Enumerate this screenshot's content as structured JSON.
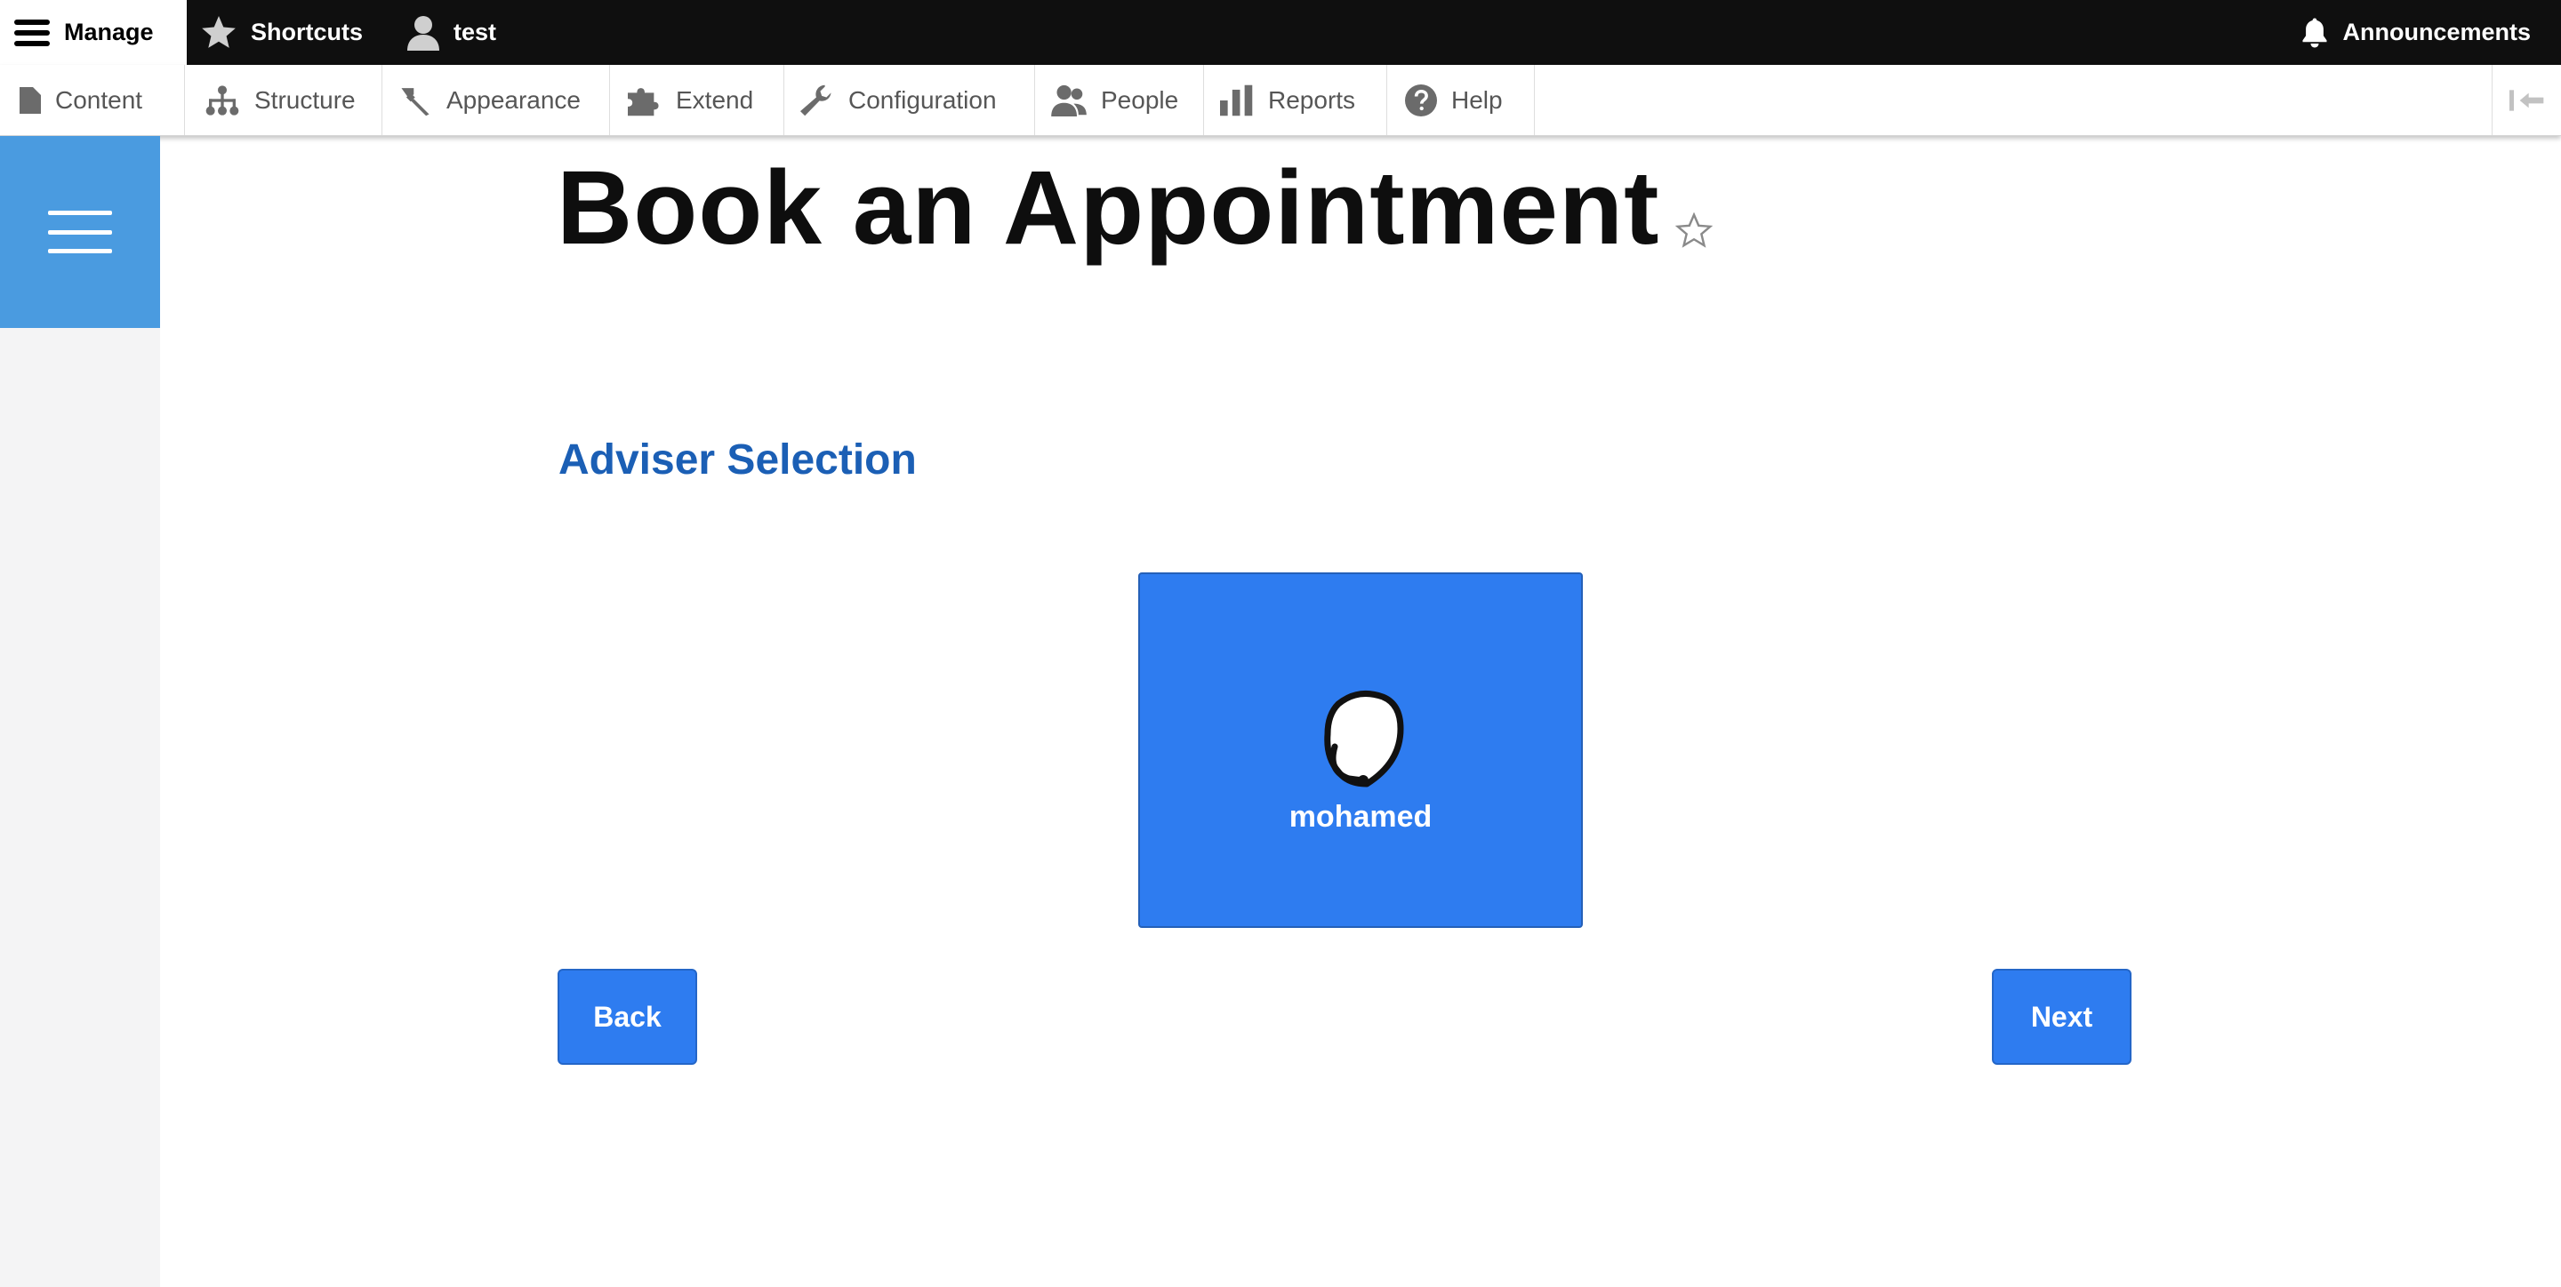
{
  "toolbar": {
    "manage_label": "Manage",
    "shortcuts_label": "Shortcuts",
    "user_label": "test",
    "announcements_label": "Announcements"
  },
  "tray": {
    "items": [
      {
        "label": "Content",
        "icon": "file-icon"
      },
      {
        "label": "Structure",
        "icon": "sitemap-icon"
      },
      {
        "label": "Appearance",
        "icon": "paintbrush-icon"
      },
      {
        "label": "Extend",
        "icon": "puzzle-icon"
      },
      {
        "label": "Configuration",
        "icon": "wrench-icon"
      },
      {
        "label": "People",
        "icon": "people-icon"
      },
      {
        "label": "Reports",
        "icon": "bar-chart-icon"
      },
      {
        "label": "Help",
        "icon": "help-icon"
      }
    ]
  },
  "page": {
    "title": "Book an Appointment"
  },
  "form": {
    "section_title": "Adviser Selection",
    "advisers": [
      {
        "name": "mohamed"
      }
    ],
    "back_label": "Back",
    "next_label": "Next"
  },
  "colors": {
    "accent": "#2e7cf0",
    "sidebar_menu": "#4a9be0",
    "section_title": "#1b5fb5",
    "topbar": "#0f0f0f"
  }
}
